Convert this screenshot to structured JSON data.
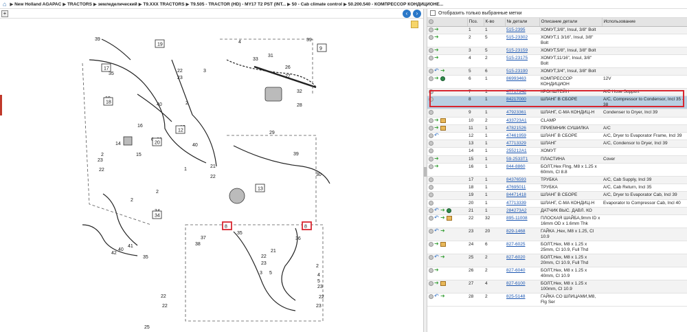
{
  "breadcrumb": [
    "New Holland AGAPAC",
    "TRACTORS",
    "земледелический",
    "T9.XXX TRACTORS",
    "T9.505 - TRACTOR (HD) - MY17 T2 PST (INT...",
    "50 - Cab climate control",
    "50.200.540 - КОМПРЕССОР КОНДИЦИОНЕ..."
  ],
  "filter": {
    "label": "Отобразить только выбранные метки"
  },
  "table": {
    "headers": {
      "pos": "Поз.",
      "qty": "К-во",
      "number": "№ детали",
      "desc": "Описание детали",
      "usage": "Использование"
    },
    "rows": [
      {
        "pos": "1",
        "qty": "1",
        "number": "515-2395",
        "desc": "ХОМУТ,3/8\", Insul, 3/8\" Bolt",
        "usage": "",
        "icons": [
          "dot",
          "arr"
        ]
      },
      {
        "pos": "2",
        "qty": "5",
        "number": "515-23302",
        "desc": "ХОМУТ,1 3/16\", Insul, 3/8\" Bolt",
        "usage": "",
        "icons": [
          "dot",
          "arr"
        ]
      },
      {
        "pos": "3",
        "qty": "5",
        "number": "515-23159",
        "desc": "ХОМУТ,5/8\", Insul, 3/8\" Bolt",
        "usage": "",
        "icons": [
          "dot",
          "arr"
        ]
      },
      {
        "pos": "4",
        "qty": "2",
        "number": "515-23175",
        "desc": "ХОМУТ,11/16\", Insul, 3/8\" Bolt",
        "usage": "",
        "icons": [
          "dot",
          "arr"
        ]
      },
      {
        "pos": "5",
        "qty": "6",
        "number": "515-23190",
        "desc": "ХОМУТ,3/4\", Insul, 3/8\" Bolt",
        "usage": "",
        "icons": [
          "dot",
          "back",
          "arr"
        ]
      },
      {
        "pos": "6",
        "qty": "1",
        "number": "86993463",
        "desc": "КОМПРЕССОР КОНДИЦИОН",
        "usage": "12V",
        "icons": [
          "dot",
          "arr",
          "globe"
        ]
      },
      {
        "pos": "7",
        "qty": "1",
        "number": "47717948",
        "desc": "КРОНШТЕЙН",
        "usage": "A/C Hose Support",
        "icons": [
          "dot"
        ]
      },
      {
        "pos": "8",
        "qty": "1",
        "number": "84217000",
        "desc": "ШЛАНГ В СБОРЕ",
        "usage": "A/C, Compressor to Condensor, Incl 35 - 38",
        "icons": [
          "dot"
        ],
        "selected": true
      },
      {
        "pos": "9",
        "qty": "1",
        "number": "47923361",
        "desc": "ШЛАНГ, С-МА КОНДИЦ-Н",
        "usage": "Condenser to Dryer, Incl 39",
        "icons": [
          "dot"
        ]
      },
      {
        "pos": "10",
        "qty": "2",
        "number": "433723A1",
        "desc": "CLAMP",
        "usage": "",
        "icons": [
          "dot",
          "arr",
          "box"
        ]
      },
      {
        "pos": "11",
        "qty": "1",
        "number": "47821526",
        "desc": "ПРИЕМНИК СУШИЛКА",
        "usage": "A/C",
        "icons": [
          "dot",
          "arr",
          "box"
        ]
      },
      {
        "pos": "12",
        "qty": "1",
        "number": "47461959",
        "desc": "ШЛАНГ В СБОРЕ",
        "usage": "A/C, Dryer to Evaporator Frame, Incl 39",
        "icons": [
          "dot",
          "back"
        ]
      },
      {
        "pos": "13",
        "qty": "1",
        "number": "47713329",
        "desc": "ШЛАНГ",
        "usage": "A/C, Condensor to Dryer, Incl 39",
        "icons": [
          "dot"
        ]
      },
      {
        "pos": "14",
        "qty": "1",
        "number": "255212A1",
        "desc": "ХОМУТ",
        "usage": "",
        "icons": [
          "dot"
        ]
      },
      {
        "pos": "15",
        "qty": "1",
        "number": "59-2533T1",
        "desc": "ПЛАСТИНА",
        "usage": "Cover",
        "icons": [
          "dot",
          "arr"
        ]
      },
      {
        "pos": "16",
        "qty": "1",
        "number": "844-8860",
        "desc": "БОЛТ,Hex Flng, M8 x 1.25 x 60mm, Cl 8.8",
        "usage": "",
        "icons": [
          "dot",
          "arr"
        ]
      },
      {
        "pos": "17",
        "qty": "1",
        "number": "84376593",
        "desc": "ТРУБКА",
        "usage": "A/C, Cab Supply, Incl 39",
        "icons": [
          "dot"
        ]
      },
      {
        "pos": "18",
        "qty": "1",
        "number": "47695011",
        "desc": "ТРУБКА",
        "usage": "A/C, Cab Return, Incl 35",
        "icons": [
          "dot"
        ]
      },
      {
        "pos": "19",
        "qty": "1",
        "number": "84471418",
        "desc": "ШЛАНГ В СБОРЕ",
        "usage": "A/C, Dryer to Evaporator Cab, Incl 39",
        "icons": [
          "dot"
        ]
      },
      {
        "pos": "20",
        "qty": "1",
        "number": "47713339",
        "desc": "ШЛАНГ, С-МА КОНДИЦ-Н",
        "usage": "Evaporator to Compressor Cab, Incl 40",
        "icons": [
          "dot"
        ]
      },
      {
        "pos": "21",
        "qty": "1",
        "number": "284273A2",
        "desc": "ДАТЧИК ВЫС. ДАВЛ. КО",
        "usage": "",
        "icons": [
          "dot",
          "back",
          "arr",
          "globe"
        ]
      },
      {
        "pos": "22",
        "qty": "32",
        "number": "895-11008",
        "desc": "ПЛОСКАЯ ШАЙБА,9mm ID x 16mm OD x 1.6mm Thk",
        "usage": "",
        "icons": [
          "dot",
          "back",
          "arr",
          "box"
        ]
      },
      {
        "pos": "23",
        "qty": "20",
        "number": "829-1468",
        "desc": "ГАЙКА ,Hex, M8 x 1.25, Cl 10.9",
        "usage": "",
        "icons": [
          "dot",
          "back",
          "arr"
        ]
      },
      {
        "pos": "24",
        "qty": "6",
        "number": "827-6025",
        "desc": "БОЛТ,Hex, M8 x 1.25 x 25mm, Cl 10.9, Full Thd",
        "usage": "",
        "icons": [
          "dot",
          "arr",
          "box"
        ]
      },
      {
        "pos": "25",
        "qty": "2",
        "number": "827-6020",
        "desc": "БОЛТ,Hex, M8 x 1.25 x 20mm, Cl 10.9, Full Thd",
        "usage": "",
        "icons": [
          "dot",
          "back",
          "arr"
        ]
      },
      {
        "pos": "26",
        "qty": "2",
        "number": "827-6040",
        "desc": "БОЛТ,Hex, M8 x 1.25 x 40mm, Cl 10.9",
        "usage": "",
        "icons": [
          "dot",
          "arr"
        ]
      },
      {
        "pos": "27",
        "qty": "4",
        "number": "827-6100",
        "desc": "БОЛТ,Hex, M8 x 1.25 x 100mm, Cl 10.9",
        "usage": "",
        "icons": [
          "dot",
          "arr",
          "box"
        ]
      },
      {
        "pos": "28",
        "qty": "2",
        "number": "825-5148",
        "desc": "ГАЙКА СО ШЛИЦАМИ,M8, Flg Ser",
        "usage": "",
        "icons": [
          "dot",
          "back",
          "arr"
        ]
      }
    ]
  },
  "diagram": {
    "labels": [
      "39",
      "19",
      "9",
      "39",
      "4",
      "33",
      "17",
      "35",
      "3",
      "22",
      "23",
      "31",
      "26",
      "27",
      "32",
      "28",
      "18",
      "40",
      "6",
      "2",
      "29",
      "16",
      "14",
      "12",
      "20",
      "15",
      "40",
      "2",
      "23",
      "22",
      "39",
      "13",
      "30",
      "2",
      "1",
      "21",
      "22",
      "2",
      "34",
      "8",
      "37",
      "38",
      "35",
      "8",
      "36",
      "41",
      "40",
      "42",
      "35",
      "21",
      "22",
      "23",
      "3",
      "5",
      "2",
      "4",
      "5",
      "23",
      "22",
      "23",
      "22",
      "22",
      "25"
    ],
    "boxed": [
      "19",
      "9",
      "17",
      "18",
      "12",
      "20",
      "13",
      "34",
      "8",
      "8"
    ],
    "highlighted": [
      "8",
      "8"
    ]
  },
  "colors": {
    "selection": "#b9cfe2",
    "selection_border": "#d8262f",
    "link": "#1a55b0",
    "nav": "#2b78c8"
  }
}
